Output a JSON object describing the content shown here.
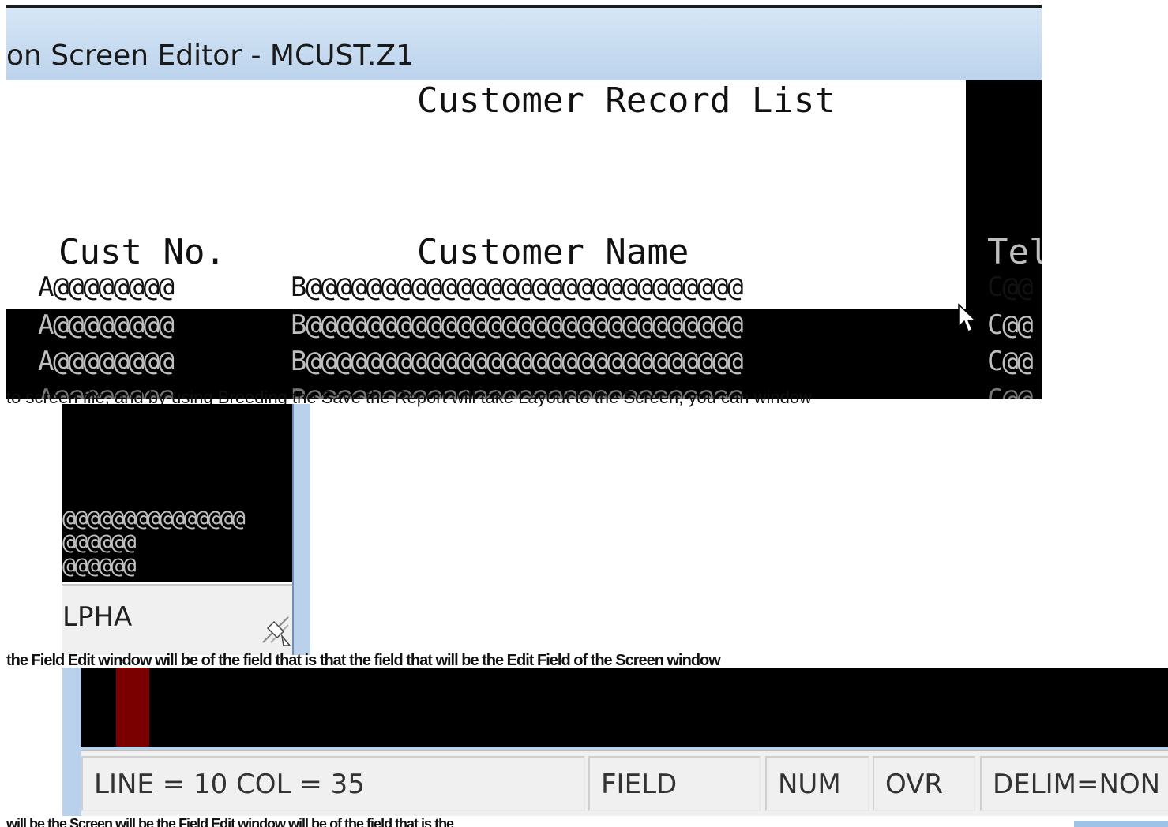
{
  "editor": {
    "title": "on Screen Editor - MCUST.Z1"
  },
  "report": {
    "title": "Customer Record List",
    "headers": {
      "cust_no": "Cust No.",
      "customer_name": "Customer Name",
      "tel": "Tel"
    },
    "rows": [
      {
        "a": "A@@@@@@@@",
        "b": "B@@@@@@@@@@@@@@@@@@@@@@@@@@@@@",
        "c": "C@@"
      },
      {
        "a": "A@@@@@@@@",
        "b": "B@@@@@@@@@@@@@@@@@@@@@@@@@@@@@",
        "c": "C@@"
      },
      {
        "a": "A@@@@@@@@",
        "b": "B@@@@@@@@@@@@@@@@@@@@@@@@@@@@@",
        "c": "C@@"
      },
      {
        "a": "A@@@@@@@@",
        "b": "B@@@@@@@@@@@@@@@@@@@@@@@@@@@@@",
        "c": "C@@"
      }
    ]
  },
  "captions": {
    "strip1": "to screen file, and by using Breeding the Save the Report will take Layout to the Screen, you can window",
    "strip2": "the Field Edit window will be of the field that is that the field that will be the Edit Field of the Screen window",
    "strip3": "will be the Screen will be the Field Edit window will be of the field that is the"
  },
  "inset": {
    "rows": [
      "@@@@@@@@@@@@@@@",
      "@@@@@@",
      "@@@@@@"
    ],
    "status": "LPHA"
  },
  "statusbar": {
    "position": "LINE = 10  COL = 35",
    "mode": "FIELD",
    "num": "NUM",
    "ovr": "OVR",
    "delim": "DELIM=NON"
  },
  "colors": {
    "titlebar": "#c8dcf0",
    "cursor_block": "#7a0000",
    "frame": "#b9d1ea"
  },
  "icons": {
    "mouse_cursor": "arrow-pointer-icon",
    "resize_grip": "resize-cursor-icon"
  }
}
